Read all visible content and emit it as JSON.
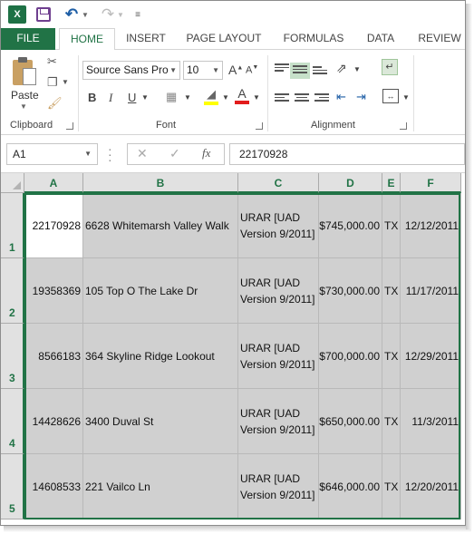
{
  "app": {
    "logo_text": "X",
    "accent": "#217346"
  },
  "tabs": [
    "FILE",
    "HOME",
    "INSERT",
    "PAGE LAYOUT",
    "FORMULAS",
    "DATA",
    "REVIEW"
  ],
  "ribbon": {
    "paste_label": "Paste",
    "clipboard_label": "Clipboard",
    "font_label": "Font",
    "alignment_label": "Alignment",
    "font_name": "Source Sans Pro",
    "font_size": "10",
    "bold": "B",
    "italic": "I",
    "underline": "U",
    "grow_font": "A",
    "shrink_font": "A",
    "font_color_letter": "A"
  },
  "formula_bar": {
    "name_box": "A1",
    "fx": "fx",
    "value": "22170928"
  },
  "columns": [
    "A",
    "B",
    "C",
    "D",
    "E",
    "F"
  ],
  "rows": [
    {
      "num": "1",
      "a": "22170928",
      "b": "6628 Whitemarsh Valley Walk",
      "c1": "URAR [UAD",
      "c2": "Version 9/2011]",
      "d": "$745,000.00",
      "e": "TX",
      "f": "12/12/2011"
    },
    {
      "num": "2",
      "a": "19358369",
      "b": "105 Top O The Lake Dr",
      "c1": "URAR [UAD",
      "c2": "Version 9/2011]",
      "d": "$730,000.00",
      "e": "TX",
      "f": "11/17/2011"
    },
    {
      "num": "3",
      "a": "8566183",
      "b": "364 Skyline Ridge Lookout",
      "c1": "URAR [UAD",
      "c2": "Version 9/2011]",
      "d": "$700,000.00",
      "e": "TX",
      "f": "12/29/2011"
    },
    {
      "num": "4",
      "a": "14428626",
      "b": "3400 Duval St",
      "c1": "URAR [UAD",
      "c2": "Version 9/2011]",
      "d": "$650,000.00",
      "e": "TX",
      "f": "11/3/2011"
    },
    {
      "num": "5",
      "a": "14608533",
      "b": "221 Vailco Ln",
      "c1": "URAR [UAD",
      "c2": "Version 9/2011]",
      "d": "$646,000.00",
      "e": "TX",
      "f": "12/20/2011"
    }
  ]
}
